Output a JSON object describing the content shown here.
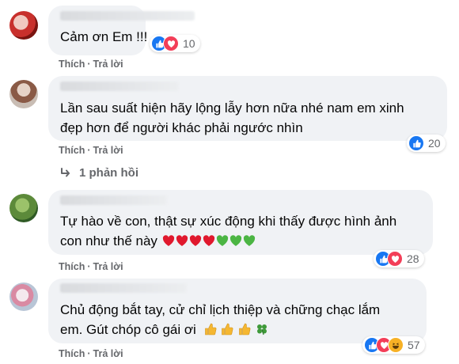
{
  "comments": [
    {
      "text_lines": [
        "Cảm ơn Em !!!"
      ],
      "like_label": "Thích",
      "reply_label": "Trả lời",
      "reaction_count": "10",
      "reaction_types": [
        "like-icon",
        "love-icon"
      ]
    },
    {
      "text_lines": [
        "Lần sau suất hiện hãy lộng lẫy hơn nữa nhé nam em xinh",
        "đẹp hơn để người khác phải ngước nhìn"
      ],
      "like_label": "Thích",
      "reply_label": "Trả lời",
      "reaction_count": "20",
      "reaction_types": [
        "like-icon"
      ],
      "replies_label": "1 phản hồi"
    },
    {
      "text_lines": [
        "Tự hào về con, thật sự xúc động khi thấy được hình ảnh",
        "con như thế này"
      ],
      "emojis": [
        "red-heart",
        "red-heart",
        "red-heart",
        "red-heart",
        "green-heart",
        "green-heart",
        "green-heart"
      ],
      "like_label": "Thích",
      "reply_label": "Trả lời",
      "reaction_count": "28",
      "reaction_types": [
        "like-icon",
        "love-icon"
      ]
    },
    {
      "text_lines": [
        "Chủ động bắt tay, cử chỉ lịch thiệp và chững chạc lắm",
        "em. Gút chóp cô gái ơi"
      ],
      "emojis": [
        "thumbs-up",
        "thumbs-up",
        "thumbs-up",
        "four-leaf-clover"
      ],
      "like_label": "Thích",
      "reply_label": "Trả lời",
      "reaction_count": "57",
      "reaction_types": [
        "like-icon",
        "love-icon",
        "haha-icon"
      ]
    }
  ],
  "colors": {
    "bubble": "#f0f2f5",
    "like": "#1877f2",
    "love": "#f33e58",
    "secondary_text": "#65676b"
  }
}
